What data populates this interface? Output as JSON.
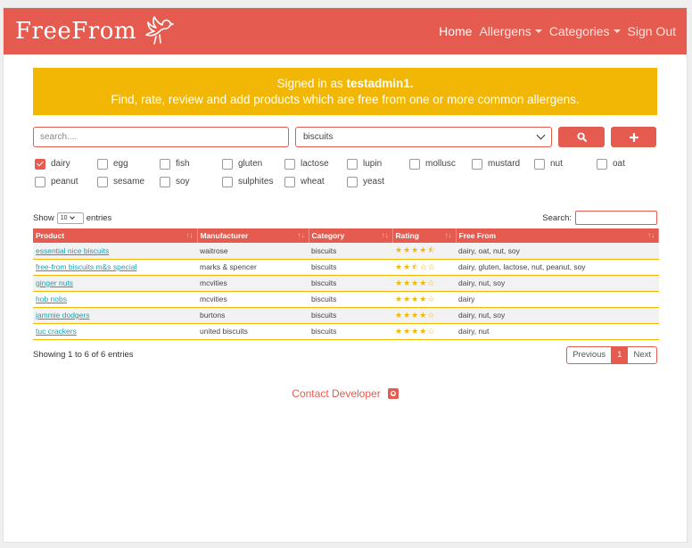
{
  "navbar": {
    "brand": "FreeFrom",
    "links": [
      {
        "label": "Home"
      },
      {
        "label": "Allergens"
      },
      {
        "label": "Categories"
      },
      {
        "label": "Sign Out"
      }
    ]
  },
  "banner": {
    "signed_in_prefix": "Signed in as ",
    "username": "testadmin1.",
    "tagline": "Find, rate, review and add products which are free from one or more common allergens."
  },
  "search": {
    "placeholder": "search....",
    "category_selected": "biscuits"
  },
  "allergens": [
    {
      "label": "dairy",
      "checked": true
    },
    {
      "label": "egg",
      "checked": false
    },
    {
      "label": "fish",
      "checked": false
    },
    {
      "label": "gluten",
      "checked": false
    },
    {
      "label": "lactose",
      "checked": false
    },
    {
      "label": "lupin",
      "checked": false
    },
    {
      "label": "mollusc",
      "checked": false
    },
    {
      "label": "mustard",
      "checked": false
    },
    {
      "label": "nut",
      "checked": false
    },
    {
      "label": "oat",
      "checked": false
    },
    {
      "label": "peanut",
      "checked": false
    },
    {
      "label": "sesame",
      "checked": false
    },
    {
      "label": "soy",
      "checked": false
    },
    {
      "label": "sulphites",
      "checked": false
    },
    {
      "label": "wheat",
      "checked": false
    },
    {
      "label": "yeast",
      "checked": false
    }
  ],
  "table_controls": {
    "show_label": "Show",
    "page_length": "10",
    "entries_label": "entries",
    "search_label": "Search:",
    "info": "Showing 1 to 6 of 6 entries",
    "prev_label": "Previous",
    "current_page": "1",
    "next_label": "Next"
  },
  "table": {
    "headers": [
      "Product",
      "Manufacturer",
      "Category",
      "Rating",
      "Free From"
    ],
    "rows": [
      {
        "product": "essential nice biscuits",
        "manufacturer": "waitrose",
        "category": "biscuits",
        "rating": 4.5,
        "free_from": "dairy, oat, nut, soy"
      },
      {
        "product": "free-from biscuits m&s special",
        "manufacturer": "marks & spencer",
        "category": "biscuits",
        "rating": 2.5,
        "free_from": "dairy, gluten, lactose, nut, peanut, soy"
      },
      {
        "product": "ginger nuts",
        "manufacturer": "mcvities",
        "category": "biscuits",
        "rating": 4,
        "free_from": "dairy, nut, soy"
      },
      {
        "product": "hob nobs",
        "manufacturer": "mcvities",
        "category": "biscuits",
        "rating": 4,
        "free_from": "dairy"
      },
      {
        "product": "jammie dodgers",
        "manufacturer": "burtons",
        "category": "biscuits",
        "rating": 4,
        "free_from": "dairy, nut, soy"
      },
      {
        "product": "tuc crackers",
        "manufacturer": "united biscuits",
        "category": "biscuits",
        "rating": 4,
        "free_from": "dairy, nut"
      }
    ]
  },
  "footer": {
    "contact_label": "Contact Developer"
  },
  "colors": {
    "primary": "#e55b4f",
    "accent": "#f2b705",
    "link": "#17a2b8"
  }
}
